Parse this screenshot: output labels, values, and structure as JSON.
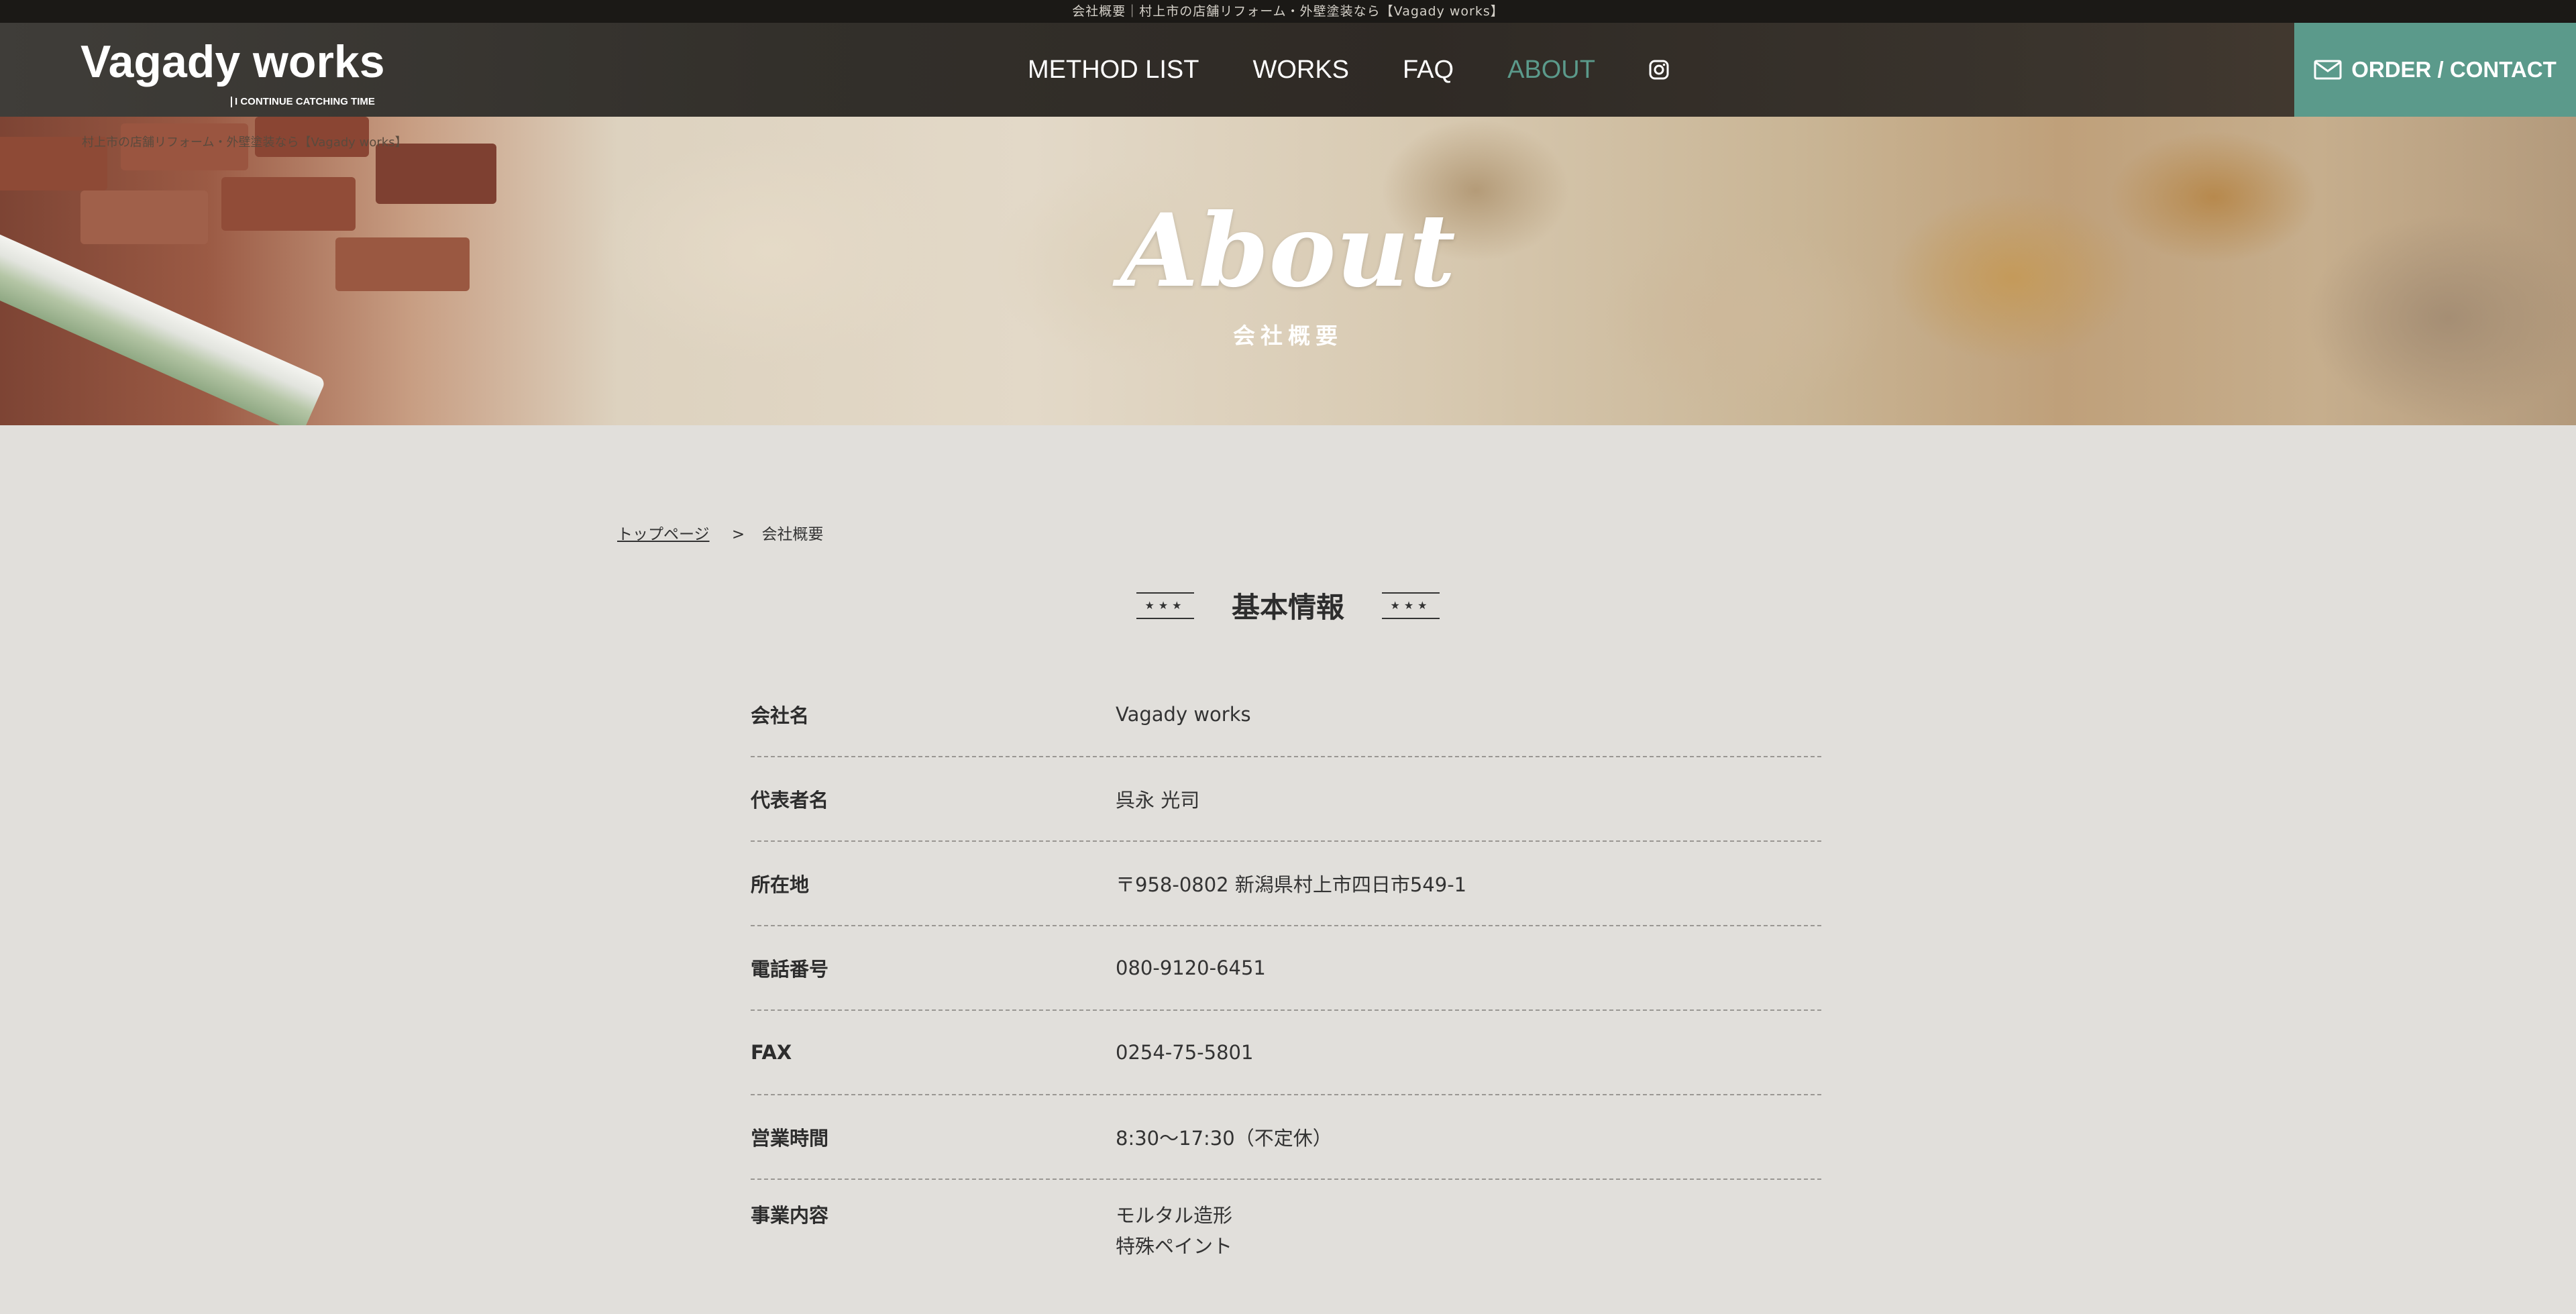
{
  "top_strip": {
    "text": "会社概要｜村上市の店舗リフォーム・外壁塗装なら【Vagady works】"
  },
  "header": {
    "logo_title": "Vagady works",
    "logo_tagline": "I CONTINUE CATCHING TIME",
    "nav": [
      {
        "label": "METHOD LIST"
      },
      {
        "label": "WORKS"
      },
      {
        "label": "FAQ"
      },
      {
        "label": "ABOUT",
        "active": true
      }
    ],
    "order_button": "ORDER / CONTACT",
    "colors": {
      "accent": "#5b9a8b"
    }
  },
  "hero": {
    "breadcrumb": "村上市の店舗リフォーム・外壁塗装なら【Vagady works】",
    "title": "About",
    "subtitle": "会社概要"
  },
  "breadcrumb": {
    "home": "トップページ",
    "separator": ">",
    "current": "会社概要"
  },
  "section": {
    "title": "基本情報",
    "ornament": "★★★"
  },
  "info": [
    {
      "label": "会社名",
      "value": "Vagady works"
    },
    {
      "label": "代表者名",
      "value": "呉永 光司"
    },
    {
      "label": "所在地",
      "value": "〒958-0802 新潟県村上市四日市549-1"
    },
    {
      "label": "電話番号",
      "value": "080-9120-6451"
    },
    {
      "label": "FAX",
      "value": "0254-75-5801"
    },
    {
      "label": "営業時間",
      "value": "8:30〜17:30（不定休）"
    },
    {
      "label": "事業内容",
      "values": [
        "モルタル造形",
        "特殊ペイント"
      ]
    }
  ]
}
